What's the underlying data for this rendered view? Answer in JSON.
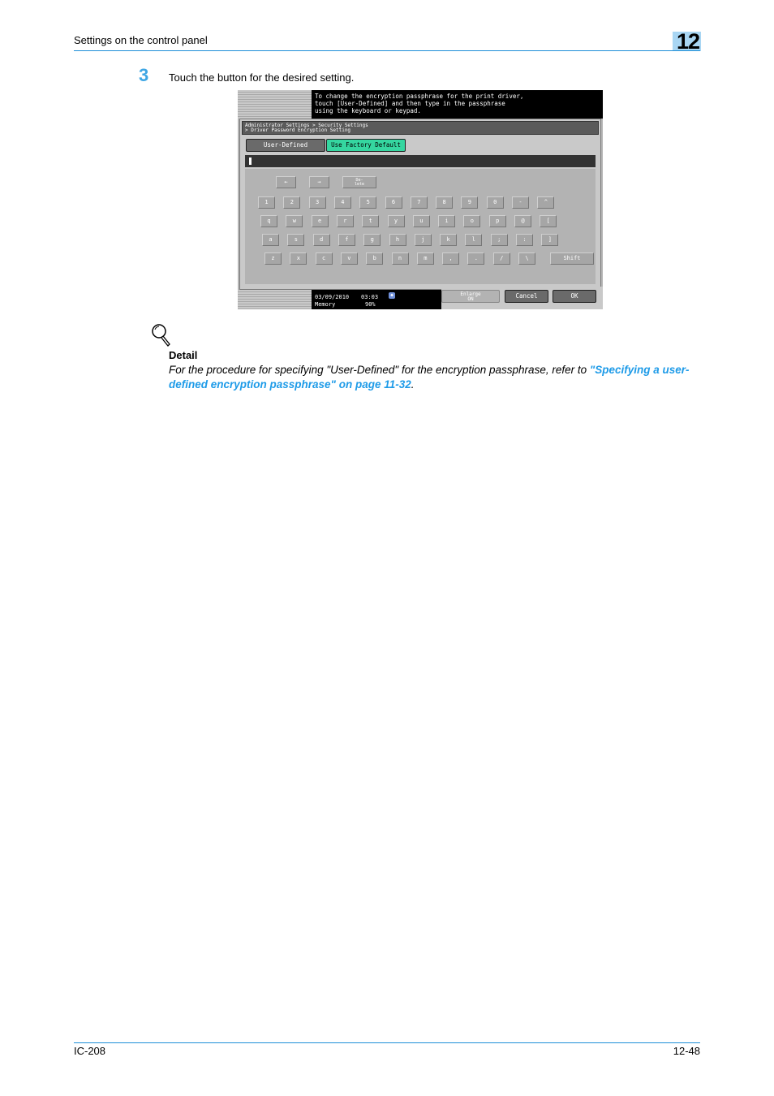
{
  "header": {
    "title": "Settings on the control panel",
    "chapter": "12"
  },
  "step": {
    "number": "3",
    "text": "Touch the button for the desired setting."
  },
  "screen": {
    "message": "To change the encryption passphrase for the print driver,\ntouch [User-Defined] and then type in the passphrase\nusing the keyboard or keypad.",
    "breadcrumb": "Administrator Settings > Security Settings\n> Driver Password Encryption Setting",
    "tabs": {
      "user_defined": "User-Defined",
      "factory_default": "Use Factory Default"
    },
    "selected_tab": "Use Factory Default",
    "input_value": "",
    "nav_keys": {
      "left": "←",
      "right": "→",
      "delete": "De-\nlete"
    },
    "rows": [
      [
        "1",
        "2",
        "3",
        "4",
        "5",
        "6",
        "7",
        "8",
        "9",
        "0",
        "-",
        "^"
      ],
      [
        "q",
        "w",
        "e",
        "r",
        "t",
        "y",
        "u",
        "i",
        "o",
        "p",
        "@",
        "["
      ],
      [
        "a",
        "s",
        "d",
        "f",
        "g",
        "h",
        "j",
        "k",
        "l",
        ";",
        ":",
        "]"
      ],
      [
        "z",
        "x",
        "c",
        "v",
        "b",
        "n",
        "m",
        ",",
        ".",
        "/",
        "\\"
      ]
    ],
    "shift_label": "Shift",
    "status": {
      "date": "03/09/2010",
      "time": "03:03",
      "memory_label": "Memory",
      "memory_value": "90%"
    },
    "buttons": {
      "enlarge": "Enlarge\nON",
      "cancel": "Cancel",
      "ok": "OK"
    },
    "colors": {
      "factory_default_bg": "#35d6a0",
      "message_bg": "#000000"
    }
  },
  "detail": {
    "heading": "Detail",
    "text_before": "For the procedure for specifying \"User-Defined\" for the encryption passphrase, refer to ",
    "link_text": "\"Specifying a user-defined encryption passphrase\" on page 11-32",
    "text_after": "."
  },
  "footer": {
    "left": "IC-208",
    "right": "12-48"
  },
  "colors": {
    "accent": "#1e8fd8",
    "step_number": "#3ea6e4",
    "link": "#1e9be8",
    "chapter_box": "#a9d6f3"
  }
}
